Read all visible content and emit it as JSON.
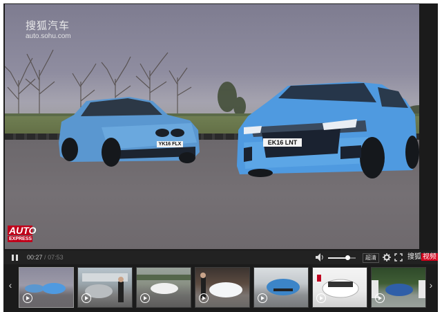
{
  "video": {
    "watermark_cn": "搜狐汽车",
    "watermark_url": "auto.sohu.com",
    "channel_logo_line1": "AUTO",
    "channel_logo_line2": "EXPRESS",
    "plate_left": "YK16 FLX",
    "plate_right": "EK16 LNT"
  },
  "controls": {
    "current_time": "00:27",
    "separator": "/",
    "duration": "07:53",
    "volume_level": 0.7,
    "quality_label": "超清",
    "brand_text": "搜狐",
    "brand_badge": "视频",
    "pause_icon": "pause-icon",
    "volume_icon": "speaker-icon",
    "settings_icon": "gear-icon",
    "fullscreen_icon": "fullscreen-icon"
  },
  "playlist": {
    "prev_arrow": "‹",
    "next_arrow": "›",
    "thumbs": [
      {
        "id": "thumb-1",
        "scene": "two blue cars on track",
        "active": true
      },
      {
        "id": "thumb-2",
        "scene": "silver car with presenter",
        "active": false
      },
      {
        "id": "thumb-3",
        "scene": "white sports car on road",
        "active": false
      },
      {
        "id": "thumb-4",
        "scene": "white compact car with presenter",
        "active": false
      },
      {
        "id": "thumb-5",
        "scene": "blue electric hatchback",
        "active": false
      },
      {
        "id": "thumb-6",
        "scene": "white electric car front",
        "active": false
      },
      {
        "id": "thumb-7",
        "scene": "blue car under trees",
        "active": false
      }
    ]
  },
  "colors": {
    "car_blue": "#5aa0dc",
    "brand_red": "#d0021b",
    "bar_bg": "#222222"
  }
}
